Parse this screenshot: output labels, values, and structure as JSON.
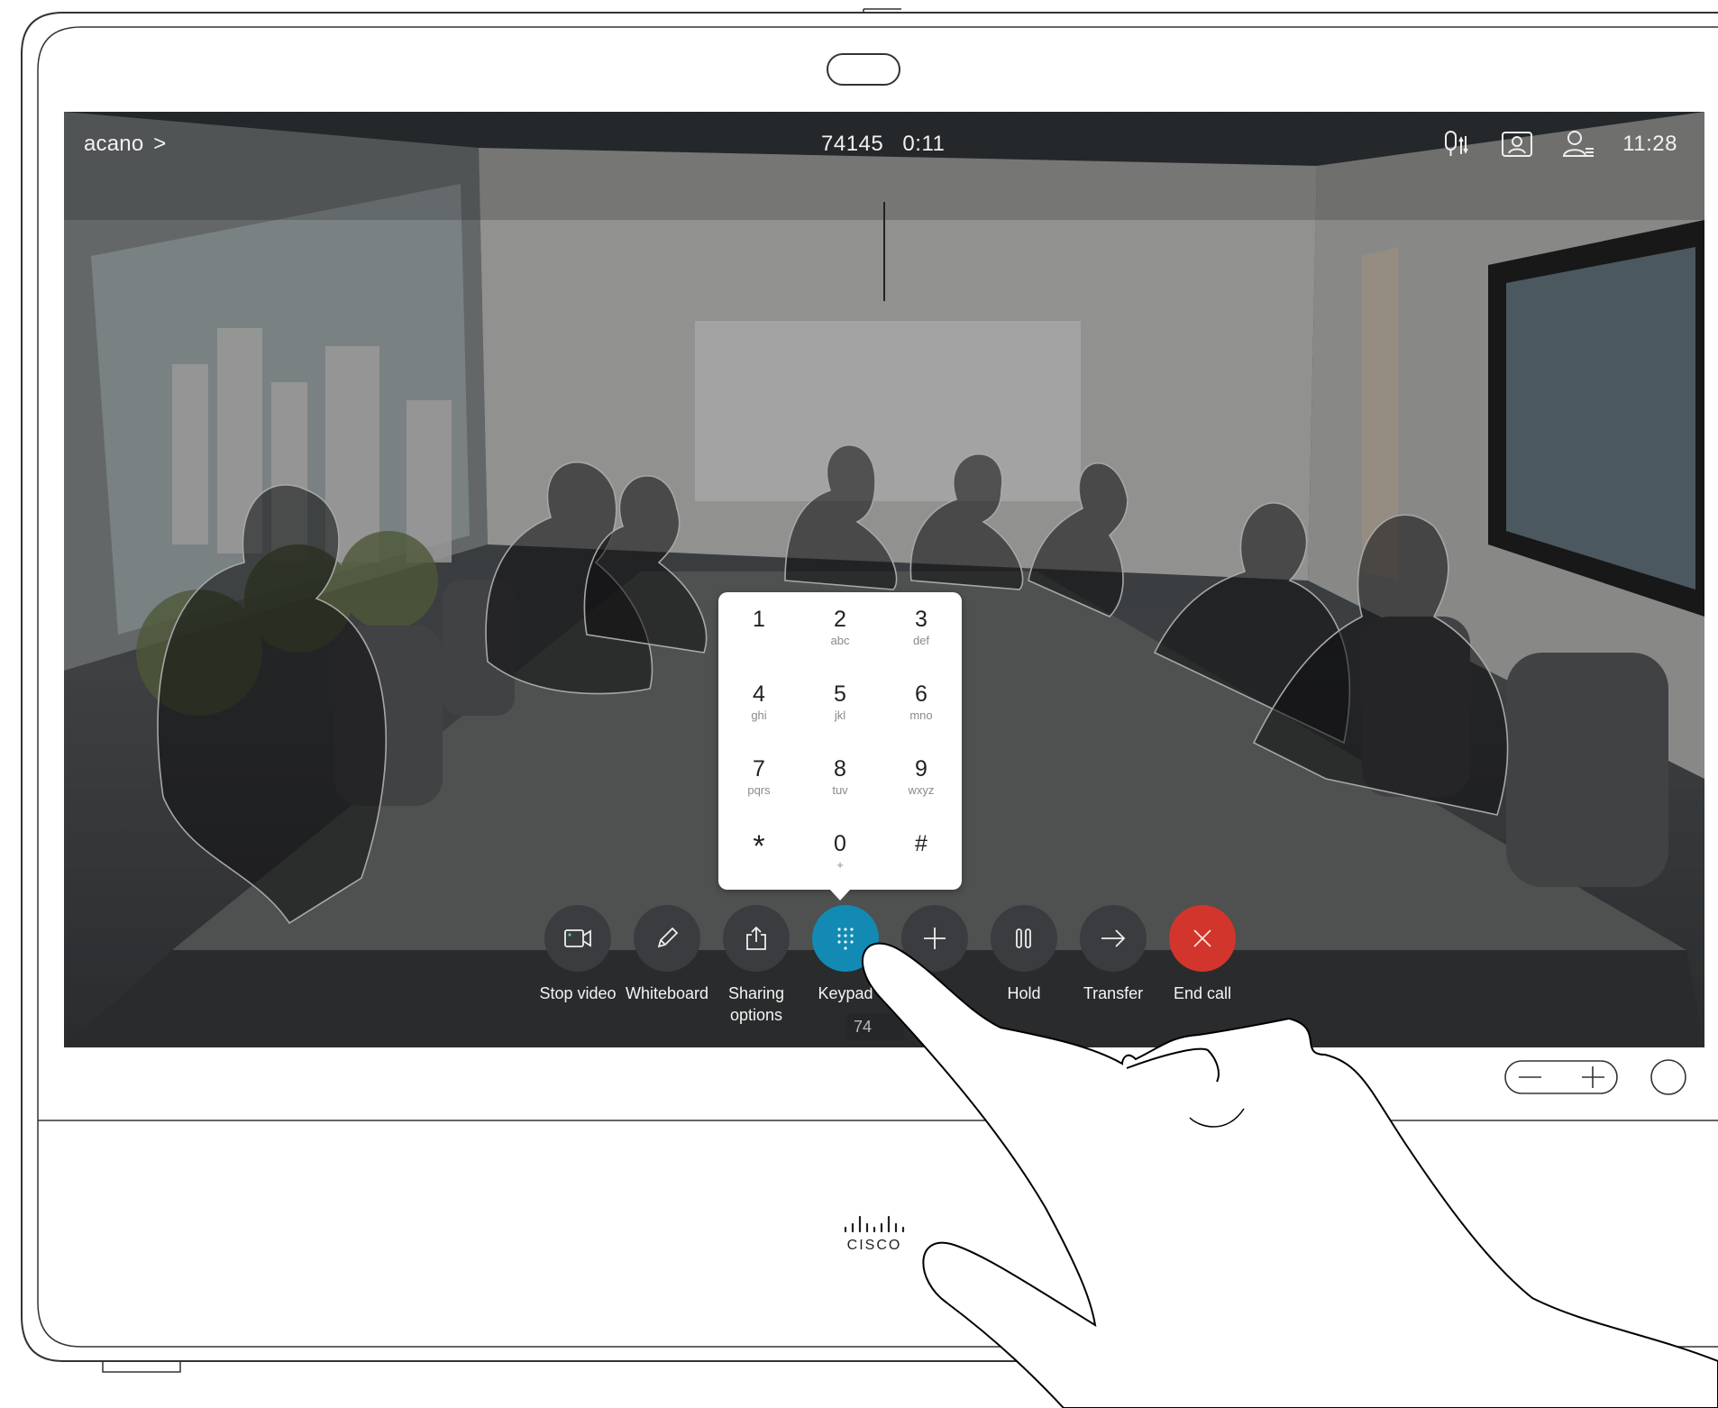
{
  "topbar": {
    "room_label": "acano",
    "room_chevron": ">",
    "call_number": "74145",
    "call_duration": "0:11",
    "clock": "11:28"
  },
  "icons": {
    "mic": "microphone-settings-icon",
    "selfview": "selfview-icon",
    "participants": "participants-icon"
  },
  "keypad": {
    "keys": [
      {
        "digit": "1",
        "sub": ""
      },
      {
        "digit": "2",
        "sub": "abc"
      },
      {
        "digit": "3",
        "sub": "def"
      },
      {
        "digit": "4",
        "sub": "ghi"
      },
      {
        "digit": "5",
        "sub": "jkl"
      },
      {
        "digit": "6",
        "sub": "mno"
      },
      {
        "digit": "7",
        "sub": "pqrs"
      },
      {
        "digit": "8",
        "sub": "tuv"
      },
      {
        "digit": "9",
        "sub": "wxyz"
      },
      {
        "digit": "*",
        "sub": ""
      },
      {
        "digit": "0",
        "sub": "+"
      },
      {
        "digit": "#",
        "sub": ""
      }
    ]
  },
  "controls": {
    "stop_video": "Stop video",
    "whiteboard": "Whiteboard",
    "sharing_1": "Sharing",
    "sharing_2": "options",
    "keypad": "Keypad",
    "keypad_badge": "74",
    "add": "",
    "hold": "Hold",
    "transfer": "Transfer",
    "end_call": "End call"
  },
  "colors": {
    "keypad_active": "#128ab3",
    "end_call": "#d1352b",
    "control_bg": "#3a3c3f"
  },
  "brand": "cisco"
}
